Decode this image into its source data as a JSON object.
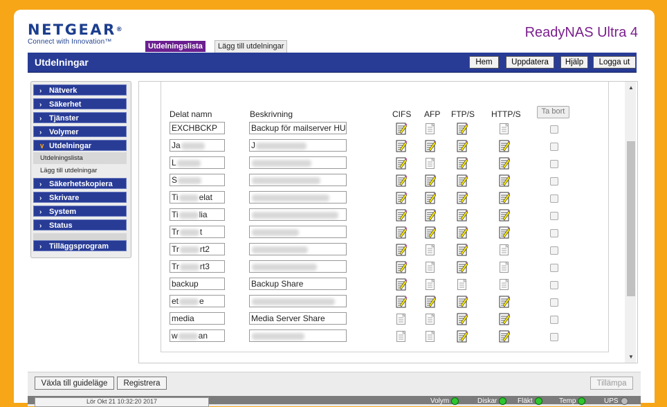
{
  "header": {
    "logo_text": "NETGEAR",
    "logo_tagline": "Connect with Innovation™",
    "product": "ReadyNAS Ultra 4"
  },
  "top_tabs": [
    "Utdelningslista",
    "Lägg till utdelningar"
  ],
  "section_title": "Utdelningar",
  "toolbar": [
    "Hem",
    "Uppdatera",
    "Hjälp",
    "Logga ut"
  ],
  "sidebar": {
    "items": [
      {
        "label": "Nätverk",
        "chevron": "›"
      },
      {
        "label": "Säkerhet",
        "chevron": "›"
      },
      {
        "label": "Tjänster",
        "chevron": "›"
      },
      {
        "label": "Volymer",
        "chevron": "›"
      },
      {
        "label": "Utdelningar",
        "chevron": "∨"
      }
    ],
    "subitems": [
      "Utdelningslista",
      "Lägg till utdelningar"
    ],
    "items2": [
      {
        "label": "Säkerhetskopiera",
        "chevron": "›"
      },
      {
        "label": "Skrivare",
        "chevron": "›"
      },
      {
        "label": "System",
        "chevron": "›"
      },
      {
        "label": "Status",
        "chevron": "›"
      }
    ],
    "addons": {
      "label": "Tilläggsprogram",
      "chevron": "›"
    }
  },
  "table": {
    "headers": {
      "name": "Delat namn",
      "desc": "Beskrivning",
      "cifs": "CIFS",
      "afp": "AFP",
      "ftp": "FTP/S",
      "http": "HTTP/S",
      "remove": "Ta bort"
    },
    "rows": [
      {
        "name": "EXCHBCKP",
        "desc": "Backup för mailserver HU",
        "cifs": "on",
        "afp": "off",
        "ftp": "on",
        "http": "off"
      },
      {
        "name": "Ja",
        "desc": "J",
        "cifs": "on",
        "afp": "on",
        "ftp": "on",
        "http": "on"
      },
      {
        "name": "L",
        "desc": "",
        "cifs": "on",
        "afp": "off",
        "ftp": "on",
        "http": "on"
      },
      {
        "name": "S",
        "desc": "",
        "cifs": "on",
        "afp": "on",
        "ftp": "on",
        "http": "on"
      },
      {
        "name": "Ti",
        "name_tail": "elat",
        "desc": "",
        "cifs": "on",
        "afp": "on",
        "ftp": "on",
        "http": "on"
      },
      {
        "name": "Ti",
        "name_tail": "lia",
        "desc": "",
        "cifs": "on",
        "afp": "on",
        "ftp": "on",
        "http": "on"
      },
      {
        "name": "Tr",
        "name_tail": "t",
        "desc": "",
        "cifs": "on",
        "afp": "on",
        "ftp": "on",
        "http": "on"
      },
      {
        "name": "Tr",
        "name_tail": "rt2",
        "desc": "",
        "cifs": "on",
        "afp": "off",
        "ftp": "on",
        "http": "off"
      },
      {
        "name": "Tr",
        "name_tail": "rt3",
        "desc": "",
        "cifs": "on",
        "afp": "off",
        "ftp": "on",
        "http": "off"
      },
      {
        "name": "backup",
        "desc": "Backup Share",
        "cifs": "on",
        "afp": "off",
        "ftp": "off",
        "http": "off"
      },
      {
        "name": "et",
        "name_tail": "e",
        "desc": "",
        "cifs": "on",
        "afp": "on",
        "ftp": "on",
        "http": "on"
      },
      {
        "name": "media",
        "desc": "Media Server Share",
        "cifs": "off",
        "afp": "off",
        "ftp": "on",
        "http": "on"
      },
      {
        "name": "w",
        "name_tail": "an",
        "desc": "",
        "cifs": "off",
        "afp": "off",
        "ftp": "on",
        "http": "on"
      }
    ]
  },
  "bottom": {
    "guide_btn": "Växla till guideläge",
    "register_btn": "Registrera",
    "apply_btn": "Tillämpa",
    "timestamp": "Lör Okt 21 10:32:20 2017",
    "leds": [
      "Volym",
      "Diskar",
      "Fläkt",
      "Temp",
      "UPS"
    ]
  },
  "colors": {
    "accent": "#283c96",
    "purple": "#6a1f8f",
    "frame": "#f7a617"
  }
}
